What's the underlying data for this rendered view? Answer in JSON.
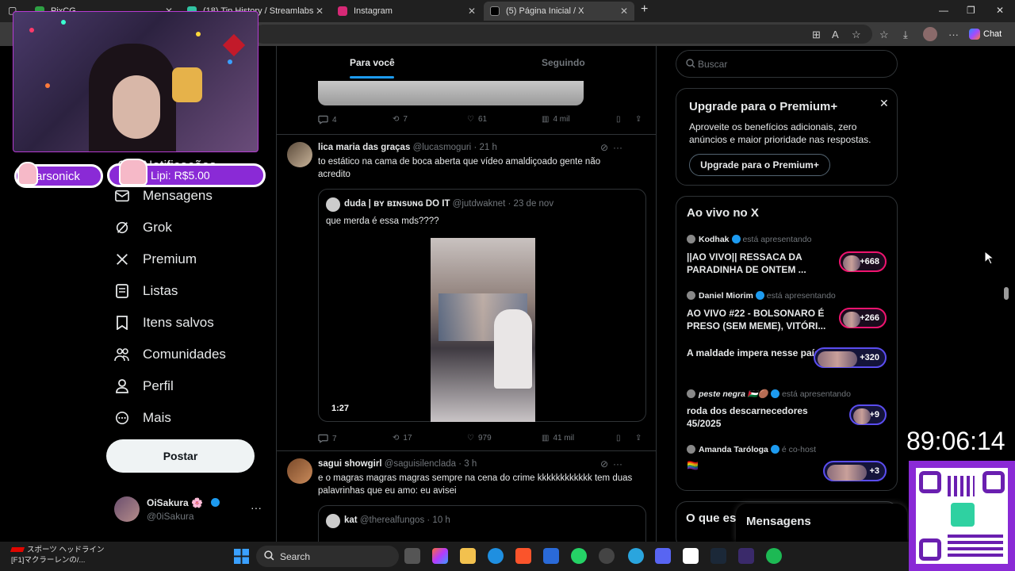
{
  "browser": {
    "tabs": [
      {
        "label": "PixCG",
        "color": "#2ea043"
      },
      {
        "label": "(18) Tip History / Streamlabs",
        "color": "#31c3a2"
      },
      {
        "label": "Instagram",
        "color": "#d62976"
      },
      {
        "label": "(5) Página Inicial / X",
        "color": "#000000"
      }
    ],
    "new_tab": "+",
    "chat_label": "Chat"
  },
  "overlay": {
    "follower_name": "arsonick",
    "tip_text": "Lipi: R$5.00",
    "timer": "89:06:14"
  },
  "nav": {
    "items": [
      {
        "label": "Notificações",
        "icon": "bell-icon"
      },
      {
        "label": "Mensagens",
        "icon": "mail-icon"
      },
      {
        "label": "Grok",
        "icon": "grok-icon"
      },
      {
        "label": "Premium",
        "icon": "x-logo-icon"
      },
      {
        "label": "Listas",
        "icon": "list-icon"
      },
      {
        "label": "Itens salvos",
        "icon": "bookmark-icon"
      },
      {
        "label": "Comunidades",
        "icon": "people-icon"
      },
      {
        "label": "Perfil",
        "icon": "person-icon"
      },
      {
        "label": "Mais",
        "icon": "more-circle-icon"
      }
    ],
    "post_button": "Postar",
    "profile": {
      "name": "OiSakura 🌸",
      "handle": "@0iSakura",
      "more": "···"
    }
  },
  "feed": {
    "tabs": [
      "Para você",
      "Seguindo"
    ],
    "prev_actions": {
      "replies": "4",
      "reposts": "7",
      "likes": "61",
      "views": "4 mil"
    },
    "posts": [
      {
        "name": "lica maria das graças",
        "handle": "@lucasmoguri",
        "time": "· 21 h",
        "text": "to estático na cama de boca aberta que vídeo amaldiçoado gente não acredito",
        "quote": {
          "name": "duda | ʙʏ ʙɪɴsᴜɴɢ DO IT",
          "handle": "@jutdwaknet",
          "time": "· 23 de nov",
          "text": "que merda é essa mds????",
          "video_duration": "1:27"
        },
        "actions": {
          "replies": "7",
          "reposts": "17",
          "likes": "979",
          "views": "41 mil"
        }
      },
      {
        "name": "sagui showgirl",
        "handle": "@saguisilenclada",
        "time": "· 3 h",
        "text": "e o magras magras magras sempre na cena do crime kkkkkkkkkkkk tem duas palavrinhas que eu amo: eu avisei",
        "quote": {
          "name": "kat",
          "handle": "@therealfungos",
          "time": "· 10 h"
        }
      }
    ]
  },
  "sidebar": {
    "search_placeholder": "Buscar",
    "premium": {
      "title": "Upgrade para o Premium+",
      "close": "✕",
      "description": "Aproveite os benefícios adicionais, zero anúncios e maior prioridade nas respostas.",
      "button": "Upgrade para o Premium+"
    },
    "live": {
      "title": "Ao vivo no X",
      "items": [
        {
          "host": "Kodhak",
          "verified": true,
          "status": "está apresentando",
          "title": "||AO VIVO|| RESSACA DA PARADINHA DE ONTEM ...",
          "count": "+668"
        },
        {
          "host": "Daniel Miorim",
          "verified": true,
          "status": "está apresentando",
          "title": "AO VIVO #22 - BOLSONARO É PRESO (SEM MEME), VITÓRI...",
          "count": "+266"
        },
        {
          "host": "",
          "verified": false,
          "status": "",
          "title": "A maldade impera nesse país!",
          "count": "+320"
        },
        {
          "host": "peste negra 🇵🇸🟤",
          "verified": true,
          "status": "está apresentando",
          "title": "roda dos descarnecedores 45/2025",
          "count": "+9"
        },
        {
          "host": "Amanda Taróloga",
          "verified": true,
          "status": "é co-host",
          "title": "🏳️‍🌈",
          "count": "+3"
        }
      ]
    },
    "trends_title": "O que es",
    "messages_title": "Mensagens"
  },
  "taskbar": {
    "news_line1": "スポーツ ヘッドライン",
    "news_line2": "[F1]マクラーレンの/...",
    "search_label": "Search"
  }
}
